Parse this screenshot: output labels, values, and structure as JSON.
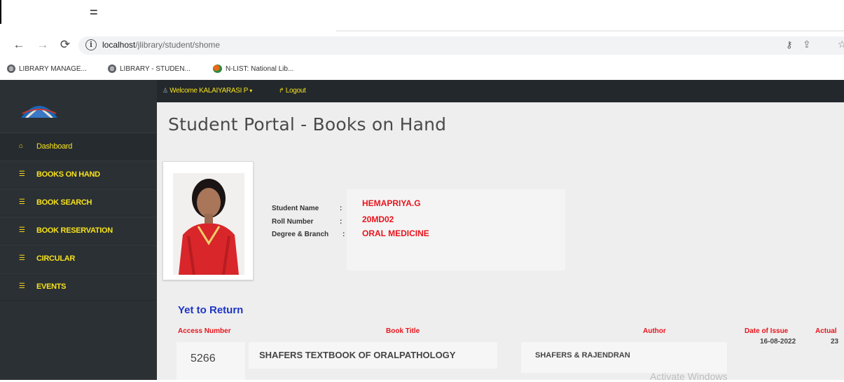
{
  "browser": {
    "menu_glyph": "=",
    "url_host": "localhost",
    "url_path": "/jlibrary/student/shome",
    "bookmarks": [
      {
        "label": "LIBRARY MANAGE...",
        "icon": "globe-icon"
      },
      {
        "label": "LIBRARY - STUDEN...",
        "icon": "globe-icon"
      },
      {
        "label": "N-LIST: National Lib...",
        "icon": "nlist-icon"
      }
    ]
  },
  "topnav": {
    "welcome": "Welcome KALAIYARASI P",
    "logout": "Logout"
  },
  "sidebar": {
    "items": [
      {
        "label": "Dashboard",
        "icon": "home-icon"
      },
      {
        "label": "BOOKS ON HAND",
        "icon": "list-icon"
      },
      {
        "label": "BOOK SEARCH",
        "icon": "list-icon"
      },
      {
        "label": "BOOK RESERVATION",
        "icon": "list-icon"
      },
      {
        "label": "CIRCULAR",
        "icon": "list-icon"
      },
      {
        "label": "EVENTS",
        "icon": "list-icon"
      }
    ]
  },
  "page": {
    "title": "Student Portal - Books on Hand"
  },
  "student": {
    "name_label": "Student Name",
    "roll_label": "Roll Number",
    "degree_label": "Degree & Branch",
    "sep": ":",
    "name": "HEMAPRIYA.G",
    "roll": "20MD02",
    "degree": "ORAL MEDICINE"
  },
  "section": {
    "heading": "Yet to Return"
  },
  "table": {
    "headers": [
      "Access Number",
      "Book Title",
      "Author",
      "Date of Issue",
      "Actual"
    ],
    "rows": [
      {
        "access": "5266",
        "title": "SHAFERS TEXTBOOK OF ORALPATHOLOGY",
        "author": "SHAFERS & RAJENDRAN",
        "date_issue": "16-08-2022",
        "actual": "23"
      }
    ]
  },
  "watermark": "Activate Windows",
  "colors": {
    "accent_yellow": "#f6e21b",
    "value_red": "#e8141c",
    "heading_blue": "#1d35c4",
    "sidebar": "#2b3034"
  }
}
